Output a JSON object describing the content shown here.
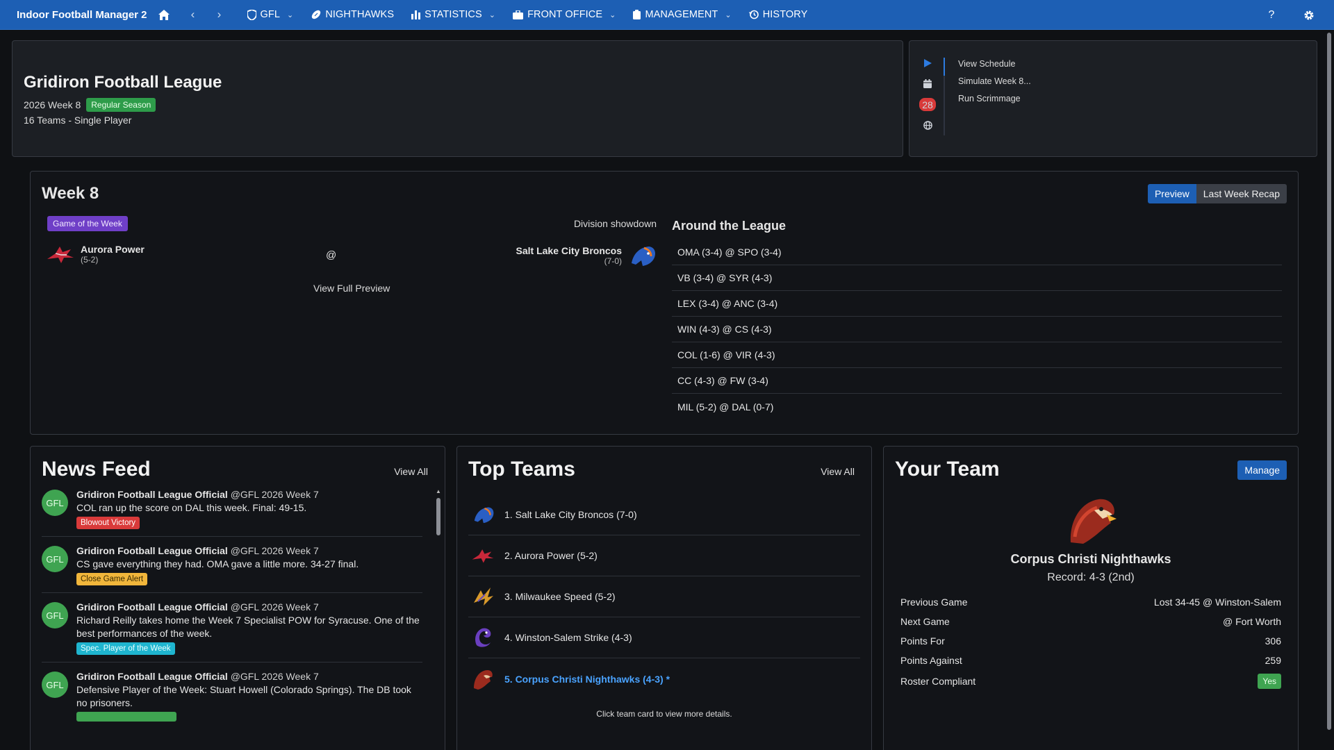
{
  "nav": {
    "brand": "Indoor Football Manager 2",
    "items": [
      {
        "label": "GFL",
        "icon": "shield-icon",
        "dropdown": true
      },
      {
        "label": "NIGHTHAWKS",
        "icon": "football-icon",
        "dropdown": false
      },
      {
        "label": "STATISTICS",
        "icon": "bar-chart-icon",
        "dropdown": true
      },
      {
        "label": "FRONT OFFICE",
        "icon": "briefcase-icon",
        "dropdown": true
      },
      {
        "label": "MANAGEMENT",
        "icon": "clipboard-icon",
        "dropdown": true
      },
      {
        "label": "HISTORY",
        "icon": "history-icon",
        "dropdown": false
      }
    ],
    "help": "?",
    "accent": "#1d5fb4"
  },
  "league": {
    "title": "Gridiron Football League",
    "week": "2026 Week 8",
    "phase": "Regular Season",
    "meta": "16 Teams - Single Player"
  },
  "sidebar": {
    "badge_count": "28",
    "links": [
      "View Schedule",
      "Simulate Week 8...",
      "Run Scrimmage"
    ]
  },
  "week": {
    "title": "Week 8",
    "tabs": {
      "preview": "Preview",
      "recap": "Last Week Recap"
    },
    "gotw_badge": "Game of the Week",
    "showdown": "Division showdown",
    "away": {
      "name": "Aurora Power",
      "record": "(5-2)"
    },
    "at": "@",
    "home": {
      "name": "Salt Lake City Broncos",
      "record": "(7-0)"
    },
    "full_preview": "View Full Preview",
    "around_title": "Around the League",
    "around": [
      "OMA (3-4) @ SPO (3-4)",
      "VB (3-4) @ SYR (4-3)",
      "LEX (3-4) @ ANC (3-4)",
      "WIN (4-3) @ CS (4-3)",
      "COL (1-6) @ VIR (4-3)",
      "CC (4-3) @ FW (3-4)",
      "MIL (5-2) @ DAL (0-7)"
    ]
  },
  "news": {
    "title": "News Feed",
    "view_all": "View All",
    "items": [
      {
        "avatar": "GFL",
        "author": "Gridiron Football League Official",
        "meta": "@GFL 2026 Week 7",
        "text": "COL ran up the score on DAL this week. Final: 49-15.",
        "tag": "Blowout Victory",
        "tag_color": "#d93a3a"
      },
      {
        "avatar": "GFL",
        "author": "Gridiron Football League Official",
        "meta": "@GFL 2026 Week 7",
        "text": "CS gave everything they had. OMA gave a little more. 34-27 final.",
        "tag": "Close Game Alert",
        "tag_color": "#f1b63b"
      },
      {
        "avatar": "GFL",
        "author": "Gridiron Football League Official",
        "meta": "@GFL 2026 Week 7",
        "text": "Richard Reilly takes home the Week 7 Specialist POW for Syracuse. One of the best performances of the week.",
        "tag": "Spec. Player of the Week",
        "tag_color": "#1fb5cf"
      },
      {
        "avatar": "GFL",
        "author": "Gridiron Football League Official",
        "meta": "@GFL 2026 Week 7",
        "text": "Defensive Player of the Week: Stuart Howell (Colorado Springs). The DB took no prisoners.",
        "tag": "",
        "tag_color": "#3fa451"
      }
    ]
  },
  "top_teams": {
    "title": "Top Teams",
    "view_all": "View All",
    "rows": [
      {
        "label": "1. Salt Lake City Broncos (7-0)",
        "logo": "bronco-logo",
        "mine": false
      },
      {
        "label": "2. Aurora Power (5-2)",
        "logo": "power-logo",
        "mine": false
      },
      {
        "label": "3. Milwaukee Speed (5-2)",
        "logo": "speed-logo",
        "mine": false
      },
      {
        "label": "4. Winston-Salem Strike (4-3)",
        "logo": "strike-logo",
        "mine": false
      },
      {
        "label": "5. Corpus Christi Nighthawks (4-3) *",
        "logo": "nighthawk-logo",
        "mine": true
      }
    ],
    "hint": "Click team card to view more details."
  },
  "your_team": {
    "title": "Your Team",
    "manage": "Manage",
    "name": "Corpus Christi Nighthawks",
    "record": "Record: 4-3 (2nd)",
    "rows": [
      {
        "label": "Previous Game",
        "value": "Lost 34-45 @ Winston-Salem"
      },
      {
        "label": "Next Game",
        "value": "@ Fort Worth"
      },
      {
        "label": "Points For",
        "value": "306"
      },
      {
        "label": "Points Against",
        "value": "259"
      }
    ],
    "compliant_label": "Roster Compliant",
    "compliant_value": "Yes"
  }
}
